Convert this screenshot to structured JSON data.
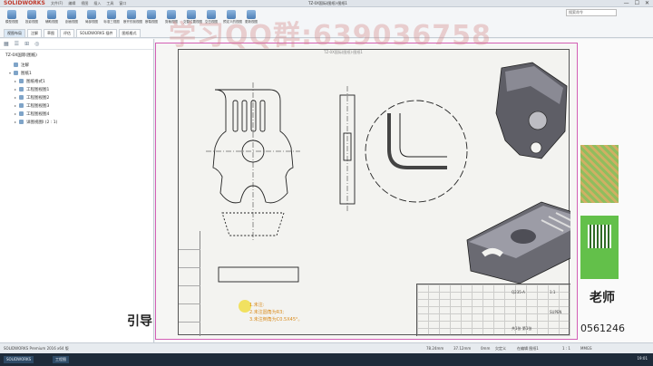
{
  "app": {
    "logo": "SOLIDWORKS",
    "document_title": "TZ-0X国际(图纸)-图纸1",
    "menu": [
      "文件(F)",
      "编辑",
      "视图",
      "插入",
      "工具",
      "窗口"
    ],
    "window_controls": [
      "—",
      "☐",
      "✕"
    ],
    "search_placeholder": "搜索命令"
  },
  "ribbon": {
    "buttons": [
      "模型视图",
      "投影视图",
      "辅助视图",
      "剖面视图",
      "局部视图",
      "标准三视图",
      "断开的剖视图",
      "断裂视图",
      "剪裁视图",
      "交替位置视图",
      "空白视图",
      "预定义的视图",
      "更新视图"
    ],
    "tabs": [
      "视图布局",
      "注解",
      "草图",
      "评估",
      "SOLIDWORKS 插件",
      "图纸格式"
    ]
  },
  "left_panel": {
    "tabs": [
      "▦",
      "☰",
      "⊞",
      "◎"
    ],
    "root": "TZ-0X国际(图纸)",
    "items": [
      {
        "twist": "",
        "label": "注解"
      },
      {
        "twist": "▾",
        "label": "图纸1"
      },
      {
        "twist": "▸",
        "label": "图纸格式1"
      },
      {
        "twist": "▸",
        "label": "工程图视图1"
      },
      {
        "twist": "▸",
        "label": "工程图视图2"
      },
      {
        "twist": "▸",
        "label": "工程图视图3"
      },
      {
        "twist": "▸",
        "label": "工程图视图4"
      },
      {
        "twist": "▸",
        "label": "详图视图I (2 : 1)"
      }
    ]
  },
  "canvas": {
    "watermark": "学习QQ群:639036758",
    "notes": [
      "1.未注:",
      "2.未注圆角为R3;",
      "3.未注倒角为C0.5X45°。"
    ],
    "title_block": {
      "material": "Q235-A",
      "scale": "1:1",
      "sheet": "共1张 第1张",
      "company": "SUPEN"
    }
  },
  "overlay": {
    "brand_left": "引导",
    "brand_teacher": "老师",
    "phone": "0561246"
  },
  "statusbar": {
    "product": "SOLIDWORKS Premium 2016 x64 版",
    "coord_x": "78.24mm",
    "coord_y": "37.12mm",
    "coord_z": "0mm",
    "state": "欠定义",
    "editing": "在编辑 图纸1",
    "scale": "1 : 1",
    "units": "MMGS"
  },
  "taskbar": {
    "items": [
      "SOLIDWORKS",
      "工程图"
    ],
    "clock": "19:01"
  }
}
